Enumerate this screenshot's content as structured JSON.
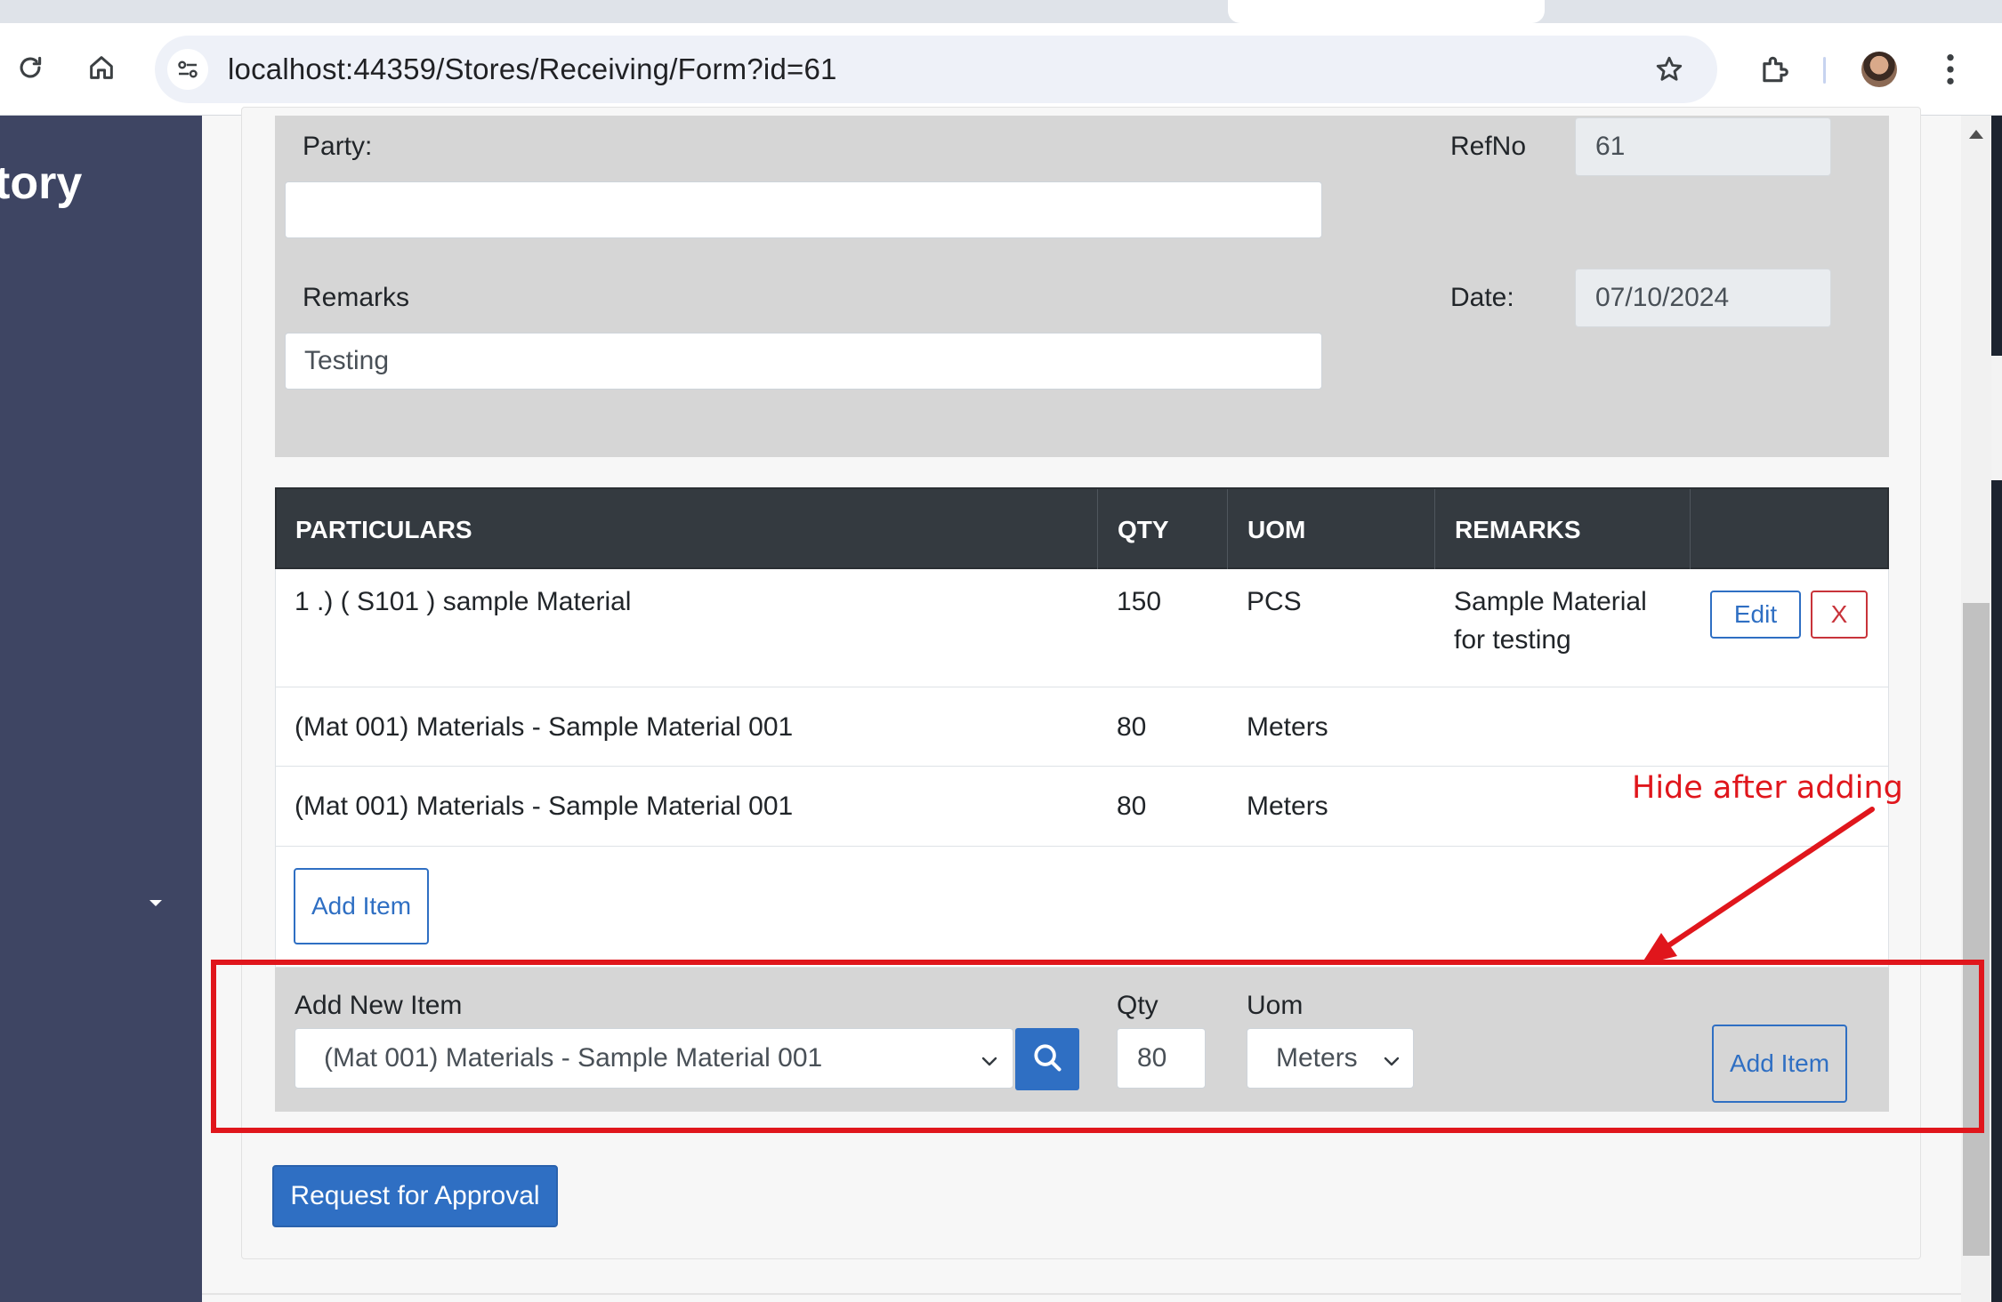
{
  "browser": {
    "url": "localhost:44359/Stores/Receiving/Form?id=61"
  },
  "sidebar": {
    "title": "tory"
  },
  "form": {
    "party_label": "Party:",
    "party_value": "",
    "refno_label": "RefNo",
    "refno_value": "61",
    "remarks_label": "Remarks",
    "remarks_value": "Testing",
    "date_label": "Date:",
    "date_value": "07/10/2024"
  },
  "table": {
    "headers": [
      "PARTICULARS",
      "QTY",
      "UOM",
      "REMARKS"
    ],
    "rows": [
      {
        "particulars": "1 .) ( S101 ) sample Material",
        "qty": "150",
        "uom": "PCS",
        "remarks_line1": "Sample Material",
        "remarks_line2": "for testing",
        "edit_label": "Edit",
        "delete_label": "X"
      },
      {
        "particulars": "(Mat 001) Materials - Sample Material 001",
        "qty": "80",
        "uom": "Meters",
        "remarks_line1": "",
        "remarks_line2": ""
      },
      {
        "particulars": "(Mat 001) Materials - Sample Material 001",
        "qty": "80",
        "uom": "Meters",
        "remarks_line1": "",
        "remarks_line2": ""
      }
    ],
    "add_item_label": "Add Item"
  },
  "add_new_item": {
    "item_label": "Add New Item",
    "item_selected": "(Mat 001) Materials - Sample Material 001",
    "qty_label": "Qty",
    "qty_value": "80",
    "uom_label": "Uom",
    "uom_selected": "Meters",
    "add_button_label": "Add Item"
  },
  "actions": {
    "request_approval_label": "Request for Approval"
  },
  "annotation": {
    "text": "Hide after adding",
    "color": "#e0161c"
  },
  "colors": {
    "primary": "#2f6fc3",
    "danger": "#c8333a",
    "table_header": "#343a40",
    "sidebar": "#3e4563"
  }
}
